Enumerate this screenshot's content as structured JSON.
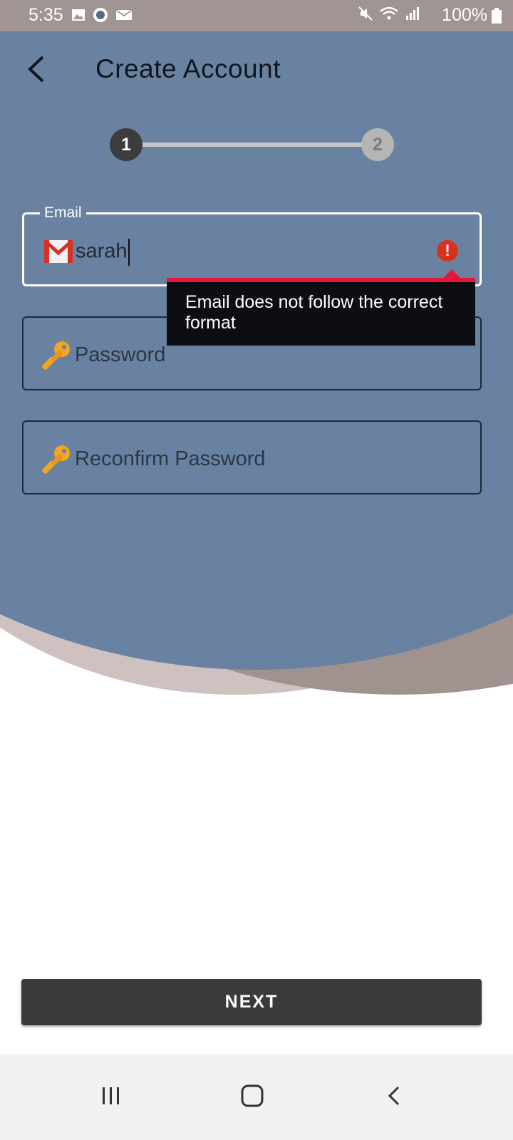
{
  "status_bar": {
    "time": "5:35",
    "battery": "100%"
  },
  "header": {
    "title": "Create Account"
  },
  "stepper": {
    "steps": [
      "1",
      "2"
    ],
    "current": 1
  },
  "form": {
    "email": {
      "label": "Email",
      "value": "sarah",
      "icon": "gmail-icon",
      "error": "Email does not follow the correct format"
    },
    "password": {
      "placeholder": "Password",
      "icon": "key-icon"
    },
    "reconfirm": {
      "placeholder": "Reconfirm Password",
      "icon": "key-icon"
    }
  },
  "actions": {
    "next_label": "NEXT"
  },
  "colors": {
    "header_bg": "#6982a2",
    "status_bar": "#a19593",
    "button": "#3a3a3a",
    "error": "#e8143a"
  }
}
